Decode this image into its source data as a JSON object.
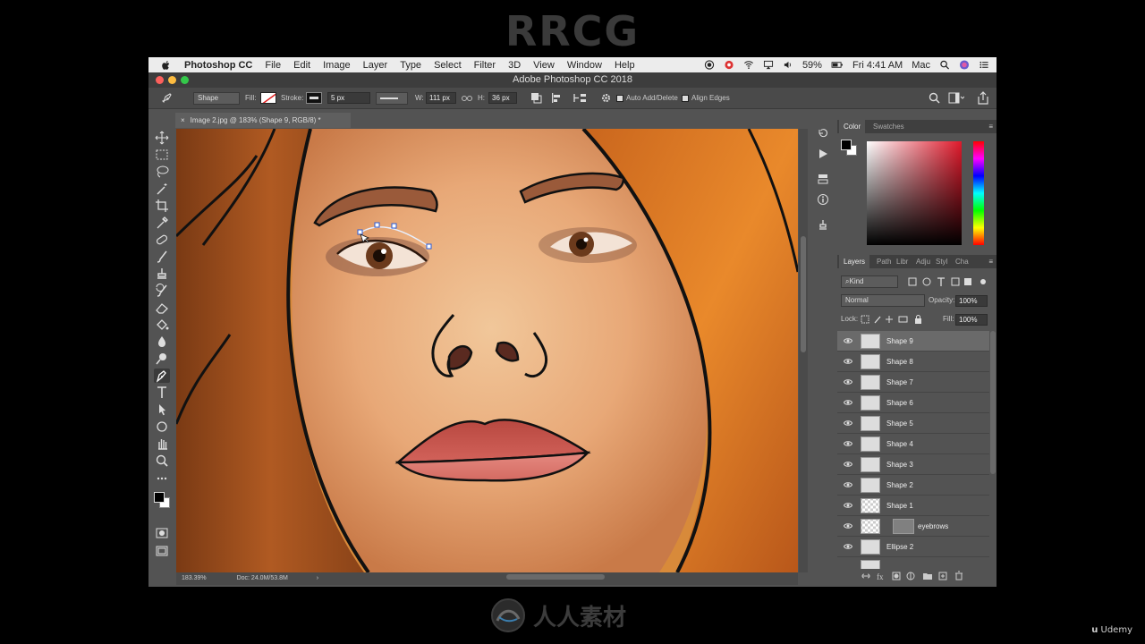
{
  "watermark": {
    "top_text": "RRCG",
    "bottom_text": "人人素材",
    "udemy_label": "Udemy"
  },
  "menubar": {
    "app_name": "Photoshop CC",
    "items": [
      "File",
      "Edit",
      "Image",
      "Layer",
      "Type",
      "Select",
      "Filter",
      "3D",
      "View",
      "Window",
      "Help"
    ],
    "battery": "59%",
    "clock": "Fri 4:41 AM",
    "user": "Mac"
  },
  "window": {
    "title": "Adobe Photoshop CC 2018"
  },
  "options": {
    "mode": "Shape",
    "fill_label": "Fill:",
    "stroke_label": "Stroke:",
    "stroke_size": "5 px",
    "w_label": "W:",
    "w_value": "111 px",
    "h_label": "H:",
    "h_value": "36 px",
    "auto_add_delete": "Auto Add/Delete",
    "align_edges": "Align Edges"
  },
  "document": {
    "tab_title": "Image 2.jpg @ 183% (Shape 9, RGB/8) *",
    "zoom": "183.39%",
    "doc_size": "Doc: 24.0M/53.8M"
  },
  "color_panel": {
    "tabs": [
      "Color",
      "Swatches"
    ],
    "active_tab": "Color",
    "foreground": "#000000",
    "background": "#ffffff"
  },
  "layers_panel": {
    "tabs": [
      "Layers",
      "Path",
      "Libr",
      "Adju",
      "Styl",
      "Cha"
    ],
    "filter": "Kind",
    "blend_mode": "Normal",
    "opacity_label": "Opacity:",
    "opacity": "100%",
    "lock_label": "Lock:",
    "fill_label": "Fill:",
    "fill": "100%",
    "layers": [
      {
        "name": "Shape 9",
        "selected": true
      },
      {
        "name": "Shape 8",
        "selected": false
      },
      {
        "name": "Shape 7",
        "selected": false
      },
      {
        "name": "Shape 6",
        "selected": false
      },
      {
        "name": "Shape 5",
        "selected": false
      },
      {
        "name": "Shape 4",
        "selected": false
      },
      {
        "name": "Shape 3",
        "selected": false
      },
      {
        "name": "Shape 2",
        "selected": false
      },
      {
        "name": "Shape 1",
        "selected": false
      },
      {
        "name": "eyebrows",
        "selected": false
      },
      {
        "name": "Ellipse 2",
        "selected": false
      }
    ]
  },
  "tools": [
    "move-tool",
    "marquee-tool",
    "lasso-tool",
    "magic-wand-tool",
    "crop-tool",
    "eyedropper-tool",
    "healing-brush-tool",
    "brush-tool",
    "clone-stamp-tool",
    "history-brush-tool",
    "eraser-tool",
    "paint-bucket-tool",
    "blur-tool",
    "dodge-tool",
    "pen-tool",
    "type-tool",
    "path-selection-tool",
    "ellipse-tool",
    "hand-tool",
    "zoom-tool",
    "more-tools"
  ]
}
